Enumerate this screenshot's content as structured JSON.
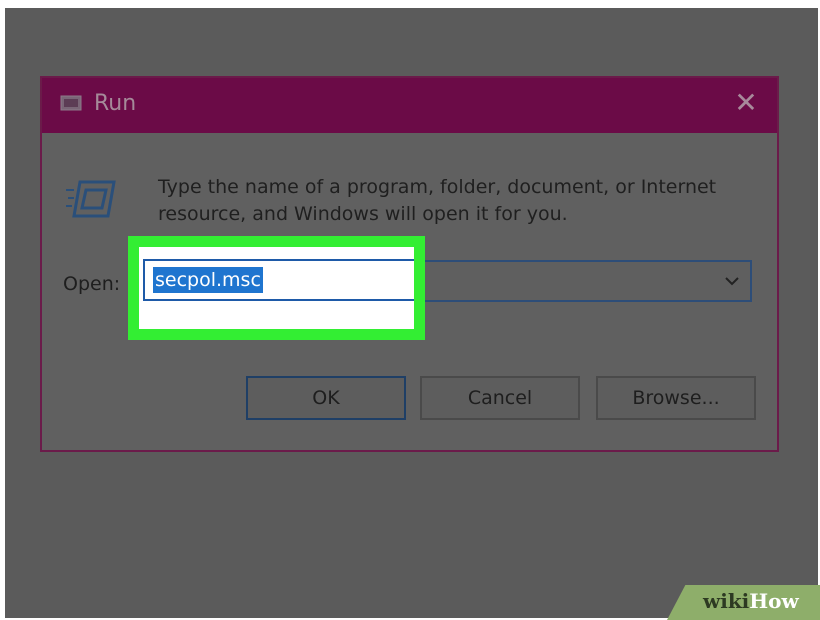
{
  "dialog": {
    "title": "Run",
    "close_symbol": "✕",
    "description": "Type the name of a program, folder, document, or Internet resource, and Windows will open it for you.",
    "open_label": "Open:",
    "input_value": "secpol.msc",
    "buttons": {
      "ok": "OK",
      "cancel": "Cancel",
      "browse": "Browse..."
    },
    "icons": {
      "title": "run-app-icon",
      "main": "run-icon",
      "dropdown": "chevron-down-icon",
      "close": "close-icon"
    }
  },
  "watermark": {
    "wiki": "wiki",
    "how": "How"
  },
  "colors": {
    "titlebar": "#6b0b47",
    "highlight": "#33ee33",
    "selection": "#1f75cf"
  }
}
